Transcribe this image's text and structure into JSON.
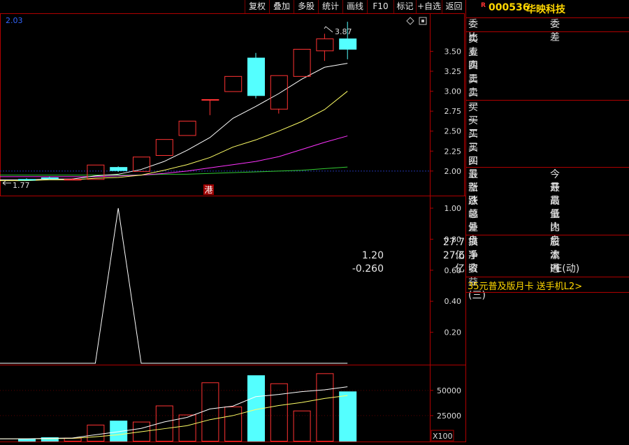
{
  "toolbar": {
    "buttons": [
      "复权",
      "叠加",
      "多股",
      "统计",
      "画线",
      "F10",
      "标记",
      "+自选",
      "返回"
    ]
  },
  "main_panel": {
    "corner_value": "2.03",
    "high_marker": "3.87",
    "low_marker": "1.77",
    "hk_badge": "港",
    "price_axis_labels": [
      "3.50",
      "3.25",
      "3.00",
      "2.75",
      "2.50",
      "2.25",
      "2.00"
    ]
  },
  "indicator_panel": {
    "axis_labels": [
      "1.00",
      "0.80",
      "0.60",
      "0.40",
      "0.20"
    ]
  },
  "volume_panel": {
    "axis_labels": [
      "50000",
      "25000"
    ],
    "unit": "X100"
  },
  "stock": {
    "badge": "R",
    "code": "000536",
    "name": "华映科技"
  },
  "order_book": {
    "ratio_label": "委比",
    "diff_label": "委差",
    "sell_levels": [
      "卖五",
      "卖四",
      "卖三",
      "卖二",
      "卖一"
    ],
    "buy_levels": [
      "买一",
      "买二",
      "买三",
      "买四",
      "买五"
    ]
  },
  "quote_stats": {
    "left": [
      "最新",
      "涨跌",
      "涨幅",
      "总量",
      "外盘"
    ],
    "right": [
      "今开",
      "最高",
      "最低",
      "量比",
      "内盘"
    ]
  },
  "fundamentals": {
    "turnover_label": "换手",
    "share_capital_label": "股本",
    "share_capital_value": "27.7亿",
    "net_assets_label": "净资",
    "net_assets_value": "1.20",
    "float_label": "流通",
    "float_value": "27.6亿",
    "eps_label": "收益(三)",
    "eps_value": "-0.260",
    "pe_label": "PE(动)"
  },
  "promo": "35元普及版月卡 送手机L2>",
  "colors": {
    "up": "#ff3333",
    "down": "#54ffff",
    "grid": "#b00000",
    "ma5": "#ffffff",
    "ma10": "#ffff66",
    "ma20": "#ff33ff",
    "ma60": "#33cc33",
    "accent": "#ffd700"
  },
  "chart_data": {
    "type": "candlestick",
    "candles": [
      {
        "o": 1.9,
        "h": 1.91,
        "l": 1.88,
        "c": 1.89
      },
      {
        "o": 1.92,
        "h": 1.93,
        "l": 1.9,
        "c": 1.91
      },
      {
        "o": 1.9,
        "h": 1.91,
        "l": 1.89,
        "c": 1.9
      },
      {
        "o": 1.9,
        "h": 2.08,
        "l": 1.9,
        "c": 2.08
      },
      {
        "o": 2.05,
        "h": 2.06,
        "l": 1.99,
        "c": 2.01
      },
      {
        "o": 2.0,
        "h": 2.18,
        "l": 2.0,
        "c": 2.18
      },
      {
        "o": 2.2,
        "h": 2.4,
        "l": 2.2,
        "c": 2.4
      },
      {
        "o": 2.45,
        "h": 2.63,
        "l": 2.45,
        "c": 2.63
      },
      {
        "o": 2.9,
        "h": 2.9,
        "l": 2.7,
        "c": 2.9
      },
      {
        "o": 3.0,
        "h": 3.19,
        "l": 3.0,
        "c": 3.19
      },
      {
        "o": 3.42,
        "h": 3.48,
        "l": 2.91,
        "c": 2.95
      },
      {
        "o": 2.78,
        "h": 3.2,
        "l": 2.72,
        "c": 3.2
      },
      {
        "o": 3.19,
        "h": 3.53,
        "l": 3.19,
        "c": 3.53
      },
      {
        "o": 3.51,
        "h": 3.72,
        "l": 3.38,
        "c": 3.66
      },
      {
        "o": 3.66,
        "h": 3.87,
        "l": 3.4,
        "c": 3.53
      }
    ],
    "ma5": [
      1.89,
      1.9,
      1.9,
      1.94,
      1.96,
      2.02,
      2.12,
      2.26,
      2.42,
      2.66,
      2.81,
      2.97,
      3.15,
      3.3,
      3.35
    ],
    "ma10": [
      1.88,
      1.89,
      1.89,
      1.91,
      1.92,
      1.95,
      2.01,
      2.08,
      2.17,
      2.3,
      2.39,
      2.5,
      2.62,
      2.77,
      3.0
    ],
    "ma20": [
      1.93,
      1.93,
      1.93,
      1.93,
      1.94,
      1.95,
      1.97,
      2.0,
      2.04,
      2.08,
      2.12,
      2.18,
      2.27,
      2.36,
      2.44
    ],
    "ma60": [
      1.95,
      1.95,
      1.95,
      1.95,
      1.95,
      1.95,
      1.96,
      1.96,
      1.97,
      1.98,
      1.99,
      2.0,
      2.01,
      2.03,
      2.05
    ],
    "indicator": [
      0,
      0,
      0,
      0,
      1.0,
      0,
      0,
      0,
      0,
      0,
      0,
      0,
      0,
      0,
      0
    ],
    "volume": [
      2000,
      3500,
      3000,
      16000,
      20000,
      19000,
      35000,
      26000,
      58000,
      34000,
      65000,
      57000,
      30000,
      67000,
      49000
    ],
    "vol_ma5": [
      2000,
      2500,
      2800,
      6000,
      9000,
      12300,
      18700,
      23200,
      31600,
      34400,
      43800,
      46000,
      48800,
      50600,
      53600
    ],
    "vol_ma10": [
      2000,
      2200,
      2400,
      4000,
      6000,
      9000,
      12000,
      15000,
      21000,
      25000,
      31000,
      35000,
      38000,
      42000,
      45000
    ],
    "price_ylim": [
      1.71,
      3.95
    ],
    "indicator_ylim": [
      0,
      1.0
    ],
    "volume_ylim": [
      0,
      70000
    ]
  }
}
